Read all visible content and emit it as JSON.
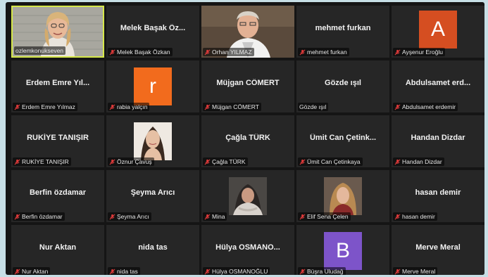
{
  "colors": {
    "tile_bg": "#262626",
    "active_border": "#d6e84a",
    "muted_icon": "#e23b3b",
    "avatar_a": "#d54e21",
    "avatar_r": "#f26b1d",
    "avatar_b": "#7d54c9"
  },
  "tiles": [
    {
      "title": "",
      "label": "ozlemkonukseven",
      "muted": false
    },
    {
      "title": "Melek Başak Öz...",
      "label": "Melek Başak Özkan",
      "muted": true
    },
    {
      "title": "",
      "label": "Orhan YILMAZ",
      "muted": true
    },
    {
      "title": "mehmet furkan",
      "label": "mehmet furkan",
      "muted": true
    },
    {
      "title": "",
      "label": "Ayşenur Eroğlu",
      "muted": true,
      "avatar_letter": "A"
    },
    {
      "title": "Erdem Emre Yıl...",
      "label": "Erdem Emre Yılmaz",
      "muted": true
    },
    {
      "title": "",
      "label": "rabia yalçın",
      "muted": true,
      "avatar_letter": "r"
    },
    {
      "title": "Müjgan CÖMERT",
      "label": "Müjgan CÖMERT",
      "muted": true
    },
    {
      "title": "Gözde ışıl",
      "label": "Gözde ışıl",
      "muted": false
    },
    {
      "title": "Abdulsamet erd...",
      "label": "Abdulsamet erdemir",
      "muted": true
    },
    {
      "title": "RUKİYE TANIŞIR",
      "label": "RUKİYE TANIŞIR",
      "muted": true
    },
    {
      "title": "",
      "label": "Öznur Çavuş",
      "muted": true
    },
    {
      "title": "Çağla TÜRK",
      "label": "Çağla TÜRK",
      "muted": true
    },
    {
      "title": "Ümit Can Çetink...",
      "label": "Ümit Can Çetinkaya",
      "muted": true
    },
    {
      "title": "Handan Dizdar",
      "label": "Handan Dizdar",
      "muted": true
    },
    {
      "title": "Berfin özdamar",
      "label": "Berfin özdamar",
      "muted": true
    },
    {
      "title": "Şeyma Arıcı",
      "label": "Şeyma Arıcı",
      "muted": true
    },
    {
      "title": "",
      "label": "Mina",
      "muted": true
    },
    {
      "title": "",
      "label": "Elif Sena Çelen",
      "muted": true
    },
    {
      "title": "hasan demir",
      "label": "hasan demir",
      "muted": true
    },
    {
      "title": "Nur Aktan",
      "label": "Nur Aktan",
      "muted": true
    },
    {
      "title": "nida tas",
      "label": "nida tas",
      "muted": true
    },
    {
      "title": "Hülya OSMANO...",
      "label": "Hülya OSMANOĞLU",
      "muted": true
    },
    {
      "title": "",
      "label": "Büşra Uludağ",
      "muted": true,
      "avatar_letter": "B"
    },
    {
      "title": "Merve Meral",
      "label": "Merve Meral",
      "muted": true
    }
  ]
}
